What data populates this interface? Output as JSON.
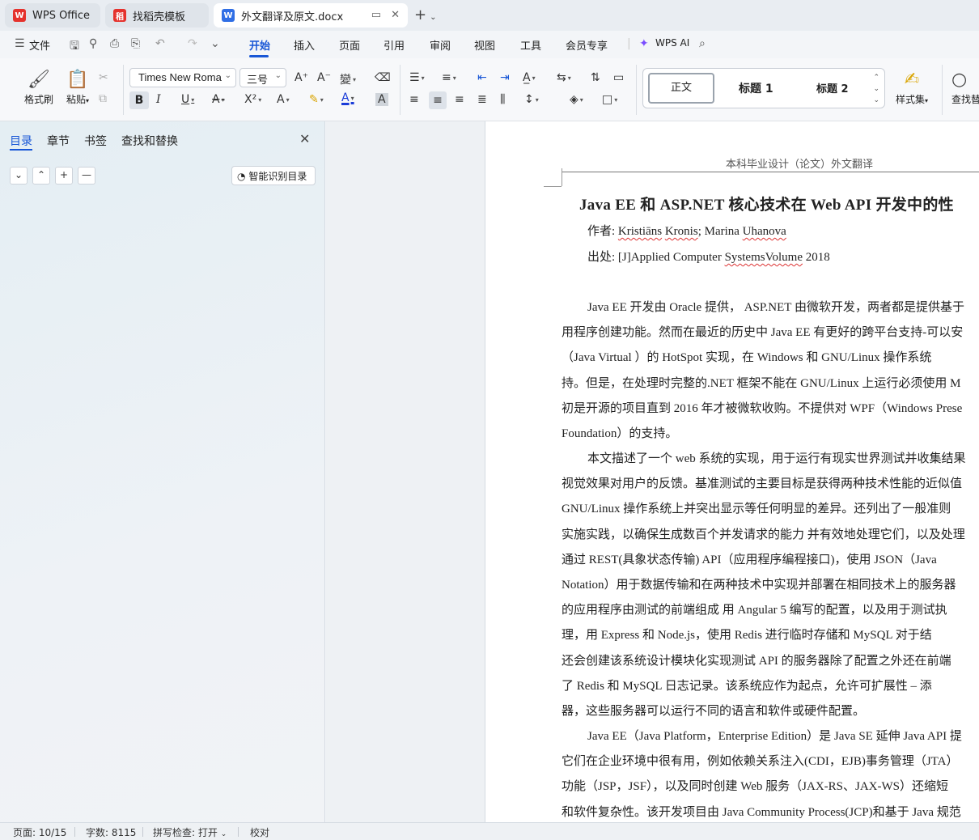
{
  "tabs": [
    {
      "label": "WPS Office",
      "icon": "wps-logo-icon"
    },
    {
      "label": "找稻壳模板",
      "icon": "docer-icon"
    },
    {
      "label": "外文翻译及原文.docx",
      "icon": "word-doc-icon"
    }
  ],
  "menu": {
    "file": "文件",
    "items": [
      "开始",
      "插入",
      "页面",
      "引用",
      "审阅",
      "视图",
      "工具",
      "会员专享"
    ],
    "active": "开始",
    "ai": "WPS AI"
  },
  "ribbon": {
    "format_painter": "格式刷",
    "paste": "粘贴",
    "font_name": "Times New Roma",
    "font_size": "三号",
    "style_normal": "正文",
    "style_h1": "标题 1",
    "style_h2": "标题 2",
    "style_set": "样式集",
    "find_replace": "查找替"
  },
  "nav_panel": {
    "tabs": [
      "目录",
      "章节",
      "书签",
      "查找和替换"
    ],
    "active_tab": "目录",
    "smart_toc": "智能识别目录"
  },
  "document": {
    "header": "本科毕业设计（论文）外文翻译",
    "title": "Java EE 和 ASP.NET 核心技术在 Web API 开发中的性",
    "author_label": "作者:",
    "author_squiggle1": "Kristiāns",
    "author_squiggle2": "Kronis",
    "author_mid": "; Marina",
    "author_squiggle3": "Uhanova",
    "source_label": "出处:",
    "source_pre": "[J]Applied Computer",
    "source_squiggle": "SystemsVolume",
    "source_post": "2018",
    "paragraphs": [
      {
        "lines": [
          "Java EE 开发由 Oracle 提供，  ASP.NET 由微软开发，两者都是提供基于",
          "用程序创建功能。然而在最近的历史中 Java EE 有更好的跨平台支持-可以安",
          "（Java Virtual  ）的  HotSpot 实现，在  Windows  和  GNU/Linux  操作系统",
          "持。但是，在处理时完整的.NET 框架不能在 GNU/Linux 上运行必须使用 M",
          "初是开源的项目直到 2016 年才被微软收购。不提供对 WPF（Windows Prese",
          "Foundation）的支持。"
        ]
      },
      {
        "lines": [
          "本文描述了一个 web 系统的实现，用于运行有现实世界测试并收集结果",
          "视觉效果对用户的反馈。基准测试的主要目标是获得两种技术性能的近似值",
          "GNU/Linux  操作系统上并突出显示等任何明显的差异。还列出了一般准则",
          "实施实践，以确保生成数百个并发请求的能力  并有效地处理它们，以及处理",
          "通过  REST(具象状态传输) API（应用程序编程接口)，使用  JSON（Java",
          "Notation）用于数据传输和在两种技术中实现并部署在相同技术上的服务器",
          "的应用程序由测试的前端组成  用  Angular 5  编写的配置，以及用于测试执",
          "理，用  Express  和  Node.js，使用  Redis  进行临时存储和  MySQL  对于结",
          "还会创建该系统设计模块化实现测试  API  的服务器除了配置之外还在前端",
          "了  Redis  和  MySQL  日志记录。该系统应作为起点，允许可扩展性  –  添",
          "器，这些服务器可以运行不同的语言和软件或硬件配置。"
        ]
      },
      {
        "lines": [
          "Java EE（Java Platform，Enterprise Edition）是  Java SE 延伸 Java API 提",
          "它们在企业环境中很有用，例如依赖关系注入(CDI，EJB)事务管理（JTA）",
          "功能（JSP，JSF），以及同时创建 Web 服务（JAX-RS、JAX-WS）还缩短",
          "和软件复杂性。该开发项目由   Java Community Process(JCP)和基于 Java  规范"
        ]
      }
    ]
  },
  "status": {
    "page": "页面: 10/15",
    "words": "字数: 8115",
    "spell": "拼写检查: 打开",
    "proof": "校对"
  },
  "colors": {
    "accent": "#1856d6",
    "wps_red": "#e5322d"
  }
}
